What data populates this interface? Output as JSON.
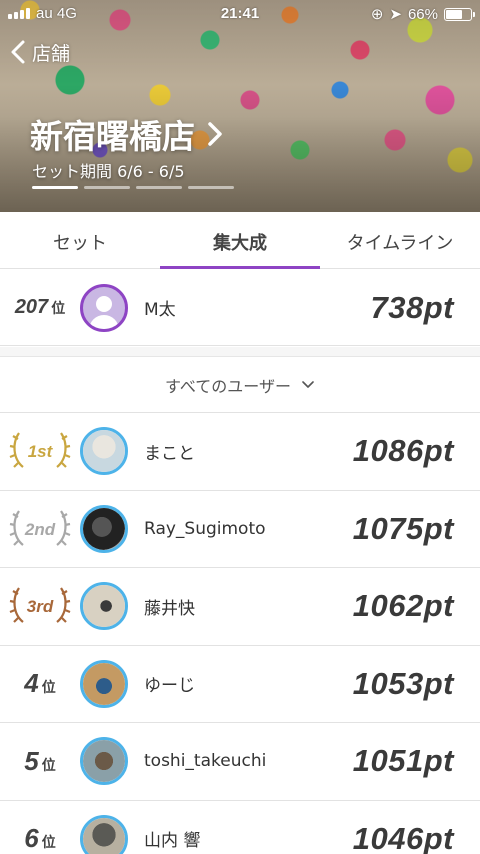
{
  "status": {
    "carrier": "au 4G",
    "time": "21:41",
    "battery": "66%"
  },
  "header": {
    "back_label": "店舗",
    "gym_name": "新宿曙橋店",
    "set_period": "セット期間 6/6 - 6/5"
  },
  "tabs": [
    {
      "label": "セット",
      "active": false
    },
    {
      "label": "集大成",
      "active": true
    },
    {
      "label": "タイムライン",
      "active": false
    }
  ],
  "my_rank": {
    "rank": "207",
    "rank_suffix": "位",
    "name": "M太",
    "points": "738pt"
  },
  "filter": {
    "label": "すべてのユーザー",
    "icon": "chevron-down-icon"
  },
  "ranking": [
    {
      "rank_label": "1st",
      "medal": "gold",
      "name": "まこと",
      "points": "1086pt"
    },
    {
      "rank_label": "2nd",
      "medal": "silver",
      "name": "Ray_Sugimoto",
      "points": "1075pt"
    },
    {
      "rank_label": "3rd",
      "medal": "bronze",
      "name": "藤井快",
      "points": "1062pt"
    },
    {
      "rank_label": "4",
      "rank_suffix": "位",
      "name": "ゆーじ",
      "points": "1053pt"
    },
    {
      "rank_label": "5",
      "rank_suffix": "位",
      "name": "toshi_takeuchi",
      "points": "1051pt"
    },
    {
      "rank_label": "6",
      "rank_suffix": "位",
      "name": "山内 響",
      "points": "1046pt"
    }
  ],
  "colors": {
    "accent": "#8e44c4",
    "avatar_ring": "#4db3e9",
    "gold": "#c9a640",
    "silver": "#a8a8a8",
    "bronze": "#a8683a"
  }
}
